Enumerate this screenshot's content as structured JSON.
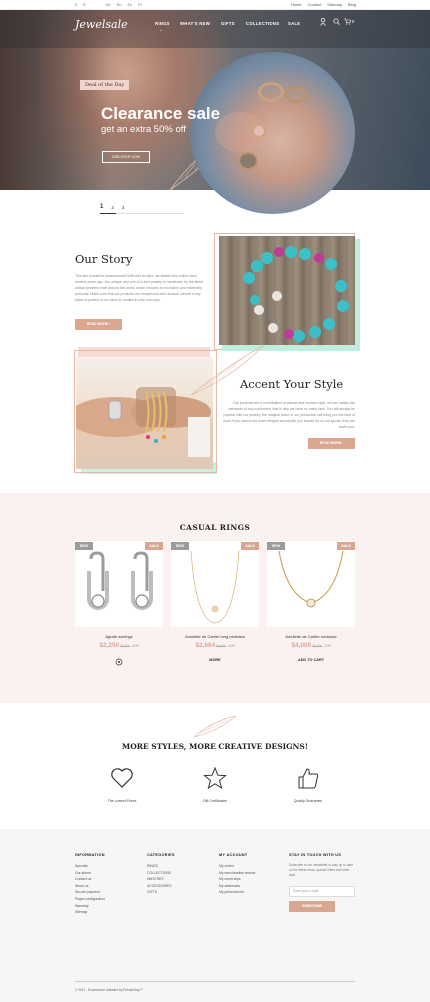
{
  "topbar": {
    "currency": "£",
    "currency2": "€",
    "languages": [
      "De",
      "En",
      "Es",
      "Fr"
    ],
    "links": [
      "Home",
      "Contact",
      "Sitemap",
      "Blog"
    ]
  },
  "header": {
    "logo": "Jewelsale",
    "nav": [
      "RINGS",
      "WHAT'S NEW",
      "GIFTS",
      "COLLECTIONS",
      "SALE"
    ],
    "cart_count": "0"
  },
  "hero": {
    "badge": "Deal of the Day",
    "title": "Clearance sale",
    "subtitle": "get an extra 50% off",
    "button": "DISCOVER NOW",
    "pagination": [
      "1",
      "2",
      "3"
    ]
  },
  "story": {
    "title": "Our Story",
    "text": "This site should be accessorized! With this in mind, we started this online store several years ago. Our unique and one-of-a-kind jewelry is handmade by the finest artisan jewelers from around the world, which ensures an exclusive and extremely personal. Make sure that our products are exceptional and unusual. Almost every piece of jewelry in our store is created in only one copy.",
    "button": "READ MORE"
  },
  "accent": {
    "title": "Accent Your Style",
    "text": "Our products are a combination of classic and modern style, we can satisfy the demands of any customers, that is why we have so many fans. You will always be popular with our jewelry, the magical shine of our production will bring you the best of luck! If you want to be more elegant and stylish you should try on our goods, they are worth you.",
    "button": "READ MORE"
  },
  "products": {
    "title": "CASUAL RINGS",
    "items": [
      {
        "name": "Agrafe earrings",
        "price": "$2,250",
        "old": "$4,500",
        "pct": "-50%",
        "new": "NEW",
        "sale": "SALE",
        "action": ""
      },
      {
        "name": "Amulette de Cartier long necklace",
        "price": "$2,664",
        "old": "$4,440",
        "pct": "-40%",
        "new": "NEW",
        "sale": "SALE",
        "action": "MORE"
      },
      {
        "name": "Amulette de Cartier necklace",
        "price": "$4,000",
        "old": "$5,000",
        "pct": "-20%",
        "new": "NEW",
        "sale": "SALE",
        "action": "ADD TO CART"
      }
    ]
  },
  "features": {
    "title": "MORE STYLES, MORE CREATIVE DESIGNS!",
    "items": [
      {
        "label": "The Lowest Prices",
        "icon": "heart-icon"
      },
      {
        "label": "Gift Certificates",
        "icon": "star-icon"
      },
      {
        "label": "Quality Guarantee",
        "icon": "thumbs-up-icon"
      }
    ]
  },
  "footer": {
    "information": {
      "title": "INFORMATION",
      "links": [
        "Specials",
        "Our stores",
        "Contact us",
        "About us",
        "Secure payment",
        "Pages configuration",
        "Warranty",
        "Sitemap"
      ]
    },
    "categories": {
      "title": "CATEGORIES",
      "links": [
        "RINGS",
        "COLLECTIONS",
        "WATCHES",
        "ACCESSORIES",
        "GIFTS"
      ]
    },
    "account": {
      "title": "MY ACCOUNT",
      "links": [
        "My orders",
        "My merchandise returns",
        "My credit slips",
        "My addresses",
        "My personal info"
      ]
    },
    "newsletter": {
      "title": "STAY IN TOUCH WITH US",
      "text": "Subscribe to our newsletter to stay up to date on the latest news, special offers and other stuff.",
      "placeholder": "Enter your e-mail",
      "button": "SUBSCRIBE"
    },
    "copyright": "© 2017 - Ecommerce software by PrestaShop™"
  },
  "colors": {
    "accent": "#d9a790",
    "badge_new": "#9b9b9b",
    "section_bg": "#f9f2f1"
  }
}
